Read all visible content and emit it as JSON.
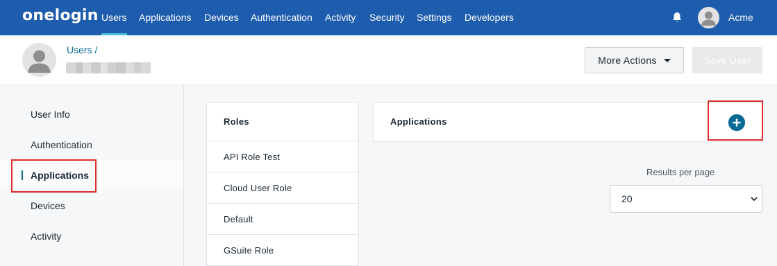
{
  "topnav": {
    "logo": "onelogin",
    "items": [
      {
        "label": "Users",
        "active": true
      },
      {
        "label": "Applications"
      },
      {
        "label": "Devices"
      },
      {
        "label": "Authentication"
      },
      {
        "label": "Activity"
      },
      {
        "label": "Security"
      },
      {
        "label": "Settings"
      },
      {
        "label": "Developers"
      }
    ],
    "account_name": "Acme",
    "icons": {
      "notifications": "bell-icon",
      "account": "user-avatar-icon"
    },
    "bg_color": "#1e5cad"
  },
  "header": {
    "breadcrumb": "Users /",
    "more_actions_label": "More Actions",
    "save_label": "Save User"
  },
  "sidebar": {
    "items": [
      {
        "label": "User Info"
      },
      {
        "label": "Authentication"
      },
      {
        "label": "Applications",
        "active": true
      },
      {
        "label": "Devices"
      },
      {
        "label": "Activity"
      }
    ]
  },
  "roles": {
    "title": "Roles",
    "items": [
      "API Role Test",
      "Cloud User Role",
      "Default",
      "GSuite Role"
    ]
  },
  "applications": {
    "title": "Applications",
    "add_icon": "plus-circle-icon",
    "results_per_page_label": "Results per page",
    "results_per_page_value": "20"
  },
  "colors": {
    "accent": "#0a6a93",
    "highlight": "#e02b2b"
  }
}
